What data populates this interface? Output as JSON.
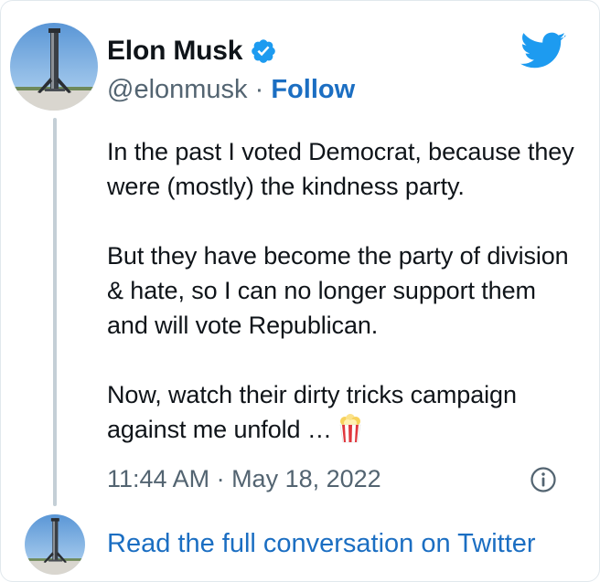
{
  "tweet": {
    "author": {
      "name": "Elon Musk",
      "handle": "@elonmusk",
      "verified": true
    },
    "separator": " · ",
    "follow_label": "Follow",
    "paragraphs": [
      "In the past I voted Democrat, because they were (mostly) the kindness party.",
      "But they have become the party of division & hate, so I can no longer support them and will vote Republican.",
      "Now, watch their dirty tricks campaign against me unfold …"
    ],
    "trailing_emoji": "popcorn-icon",
    "timestamp": "11:44 AM · May 18, 2022"
  },
  "footer": {
    "read_full_label": "Read the full conversation on Twitter"
  },
  "icons": {
    "brand": "twitter-bird-icon",
    "verified": "verified-badge-icon",
    "info": "info-icon"
  },
  "colors": {
    "brand_blue": "#1d9bf0",
    "link_blue": "#1b6ec2",
    "secondary_text": "#536471",
    "primary_text": "#0f1419",
    "thread_line": "#c4cfd6"
  }
}
